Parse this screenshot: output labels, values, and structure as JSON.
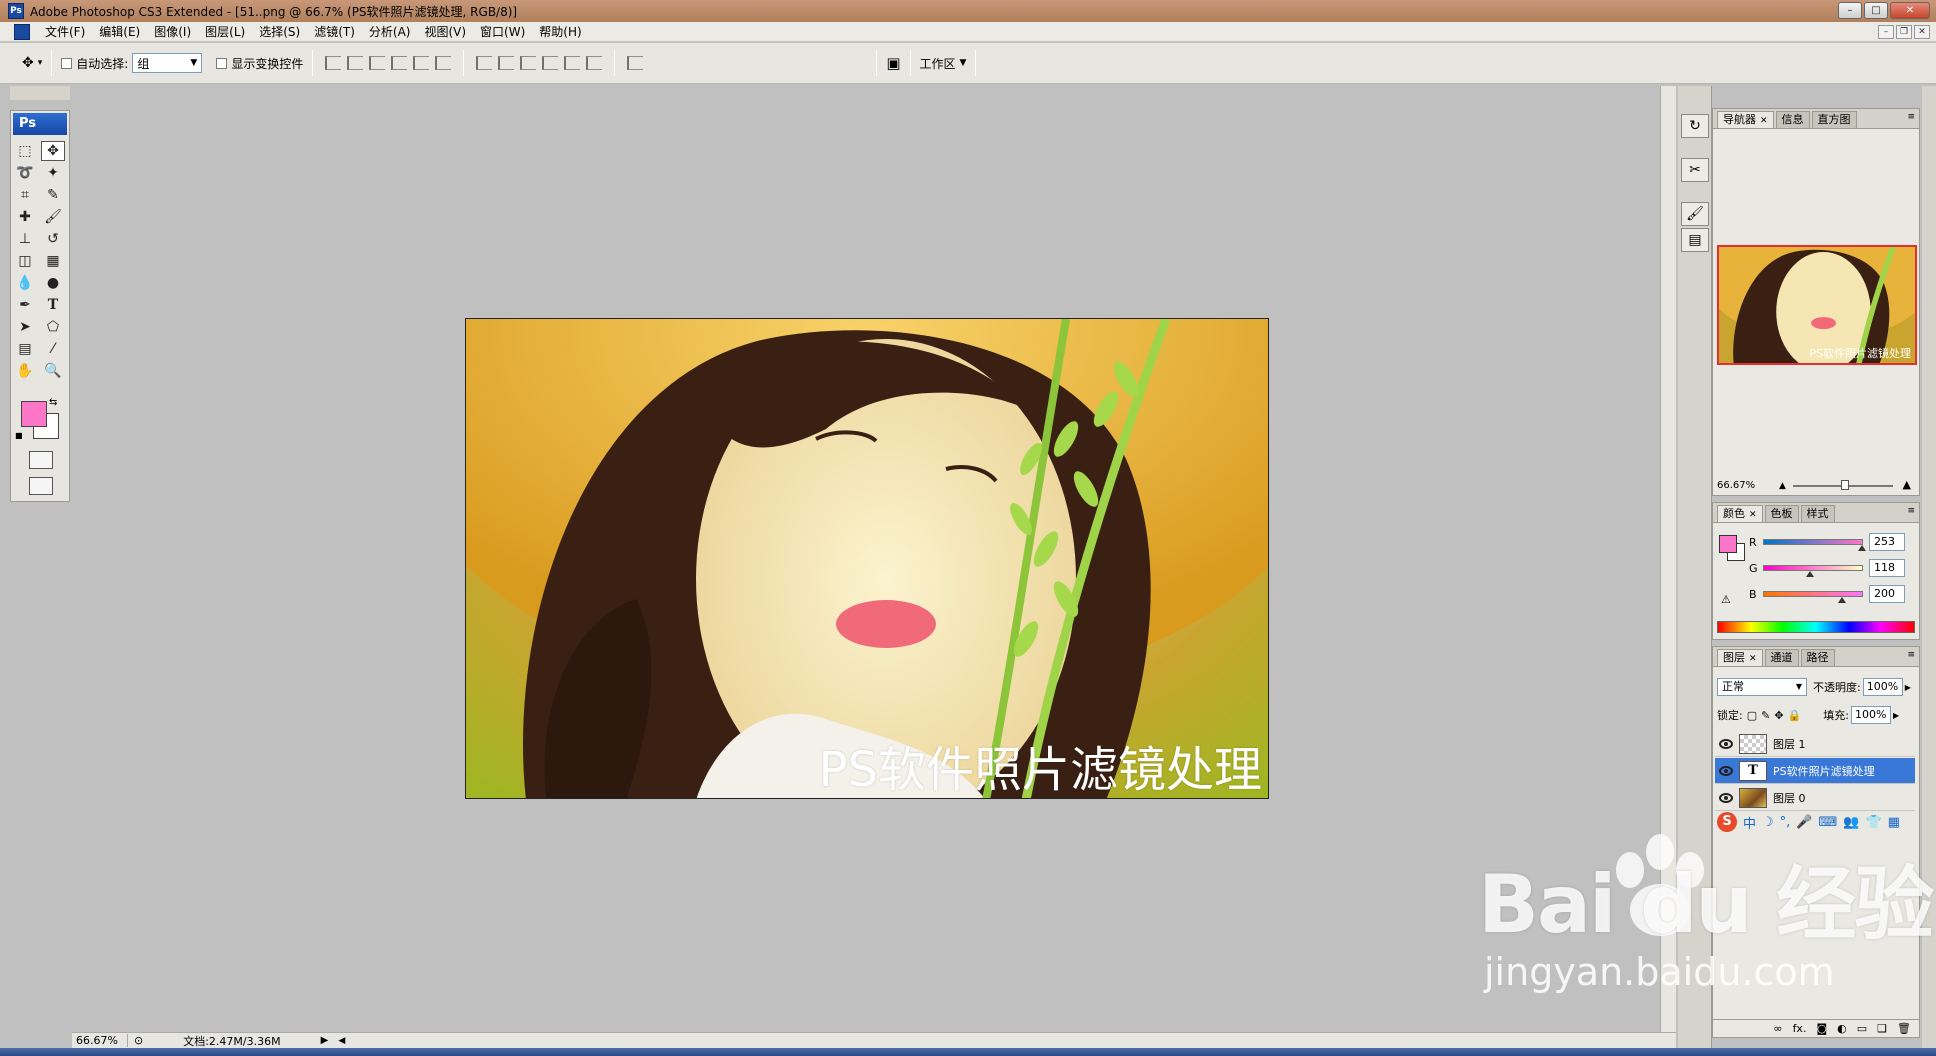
{
  "window": {
    "title": "Adobe Photoshop CS3 Extended - [51..png @ 66.7% (PS软件照片滤镜处理, RGB/8)]",
    "app_badge": "Ps"
  },
  "menu": [
    "文件(F)",
    "编辑(E)",
    "图像(I)",
    "图层(L)",
    "选择(S)",
    "滤镜(T)",
    "分析(A)",
    "视图(V)",
    "窗口(W)",
    "帮助(H)"
  ],
  "options": {
    "auto_select_label": "自动选择:",
    "auto_select_value": "组",
    "show_transform_label": "显示变换控件",
    "workspace_label": "工作区"
  },
  "canvas": {
    "overlay_text": "PS软件照片滤镜处理"
  },
  "status": {
    "zoom": "66.67%",
    "doc_info": "文档:2.47M/3.36M"
  },
  "navigator": {
    "tabs": [
      "导航器",
      "信息",
      "直方图"
    ],
    "zoom": "66.67%",
    "thumb_text": "PS软件照片滤镜处理"
  },
  "color_panel": {
    "tabs": [
      "颜色",
      "色板",
      "样式"
    ],
    "r_label": "R",
    "r": "253",
    "g_label": "G",
    "g": "118",
    "b_label": "B",
    "b": "200",
    "foreground": "#fd76c8"
  },
  "layers": {
    "tabs": [
      "图层",
      "通道",
      "路径"
    ],
    "blend_mode": "正常",
    "opacity_label": "不透明度:",
    "opacity": "100%",
    "lock_label": "锁定:",
    "fill_label": "填充:",
    "fill": "100%",
    "items": [
      {
        "name": "图层 1",
        "selected": false
      },
      {
        "name": "PS软件照片滤镜处理",
        "selected": true
      },
      {
        "name": "图层 0",
        "selected": false
      }
    ],
    "footer_fx": "fx."
  },
  "ime": {
    "logo": "S",
    "mode": "中"
  },
  "watermark": {
    "brand": "Bai du 经验",
    "url": "jingyan.baidu.com"
  }
}
